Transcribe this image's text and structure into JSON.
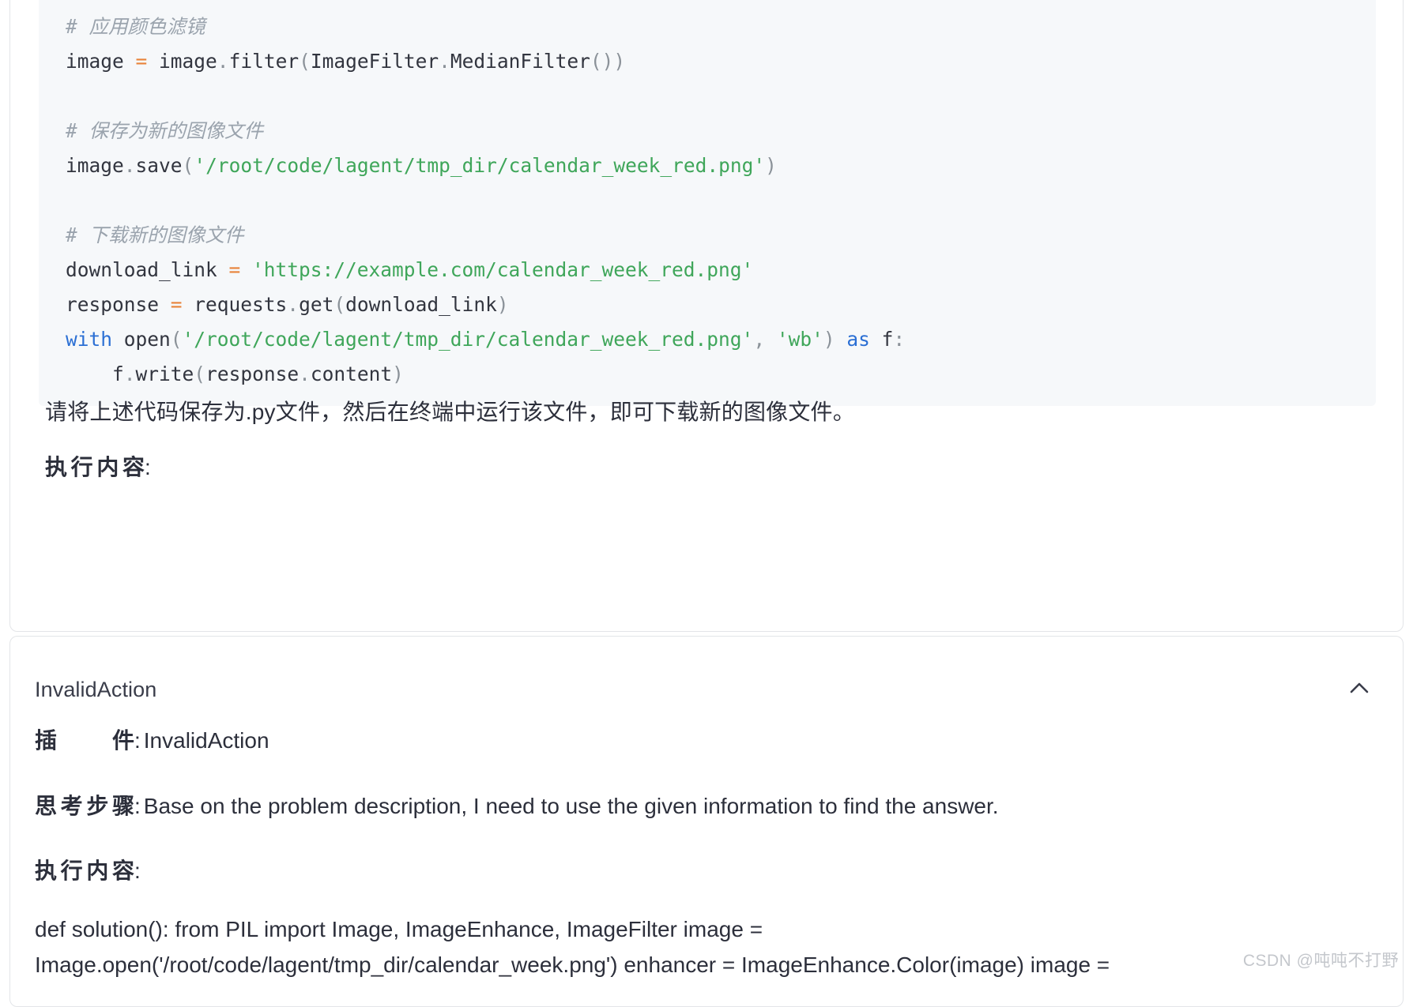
{
  "code_block": {
    "language": "python",
    "lines": [
      [
        {
          "t": "# 应用颜色滤镜",
          "c": "cmt"
        }
      ],
      [
        {
          "t": "image ",
          "c": "pln"
        },
        {
          "t": "=",
          "c": "op"
        },
        {
          "t": " image",
          "c": "pln"
        },
        {
          "t": ".",
          "c": "punc"
        },
        {
          "t": "filter",
          "c": "pln"
        },
        {
          "t": "(",
          "c": "punc"
        },
        {
          "t": "ImageFilter",
          "c": "pln"
        },
        {
          "t": ".",
          "c": "punc"
        },
        {
          "t": "MedianFilter",
          "c": "pln"
        },
        {
          "t": "())",
          "c": "punc"
        }
      ],
      [
        {
          "t": "",
          "c": "pln"
        }
      ],
      [
        {
          "t": "# 保存为新的图像文件",
          "c": "cmt"
        }
      ],
      [
        {
          "t": "image",
          "c": "pln"
        },
        {
          "t": ".",
          "c": "punc"
        },
        {
          "t": "save",
          "c": "pln"
        },
        {
          "t": "(",
          "c": "punc"
        },
        {
          "t": "'/root/code/lagent/tmp_dir/calendar_week_red.png'",
          "c": "str"
        },
        {
          "t": ")",
          "c": "punc"
        }
      ],
      [
        {
          "t": "",
          "c": "pln"
        }
      ],
      [
        {
          "t": "# 下载新的图像文件",
          "c": "cmt"
        }
      ],
      [
        {
          "t": "download_link ",
          "c": "pln"
        },
        {
          "t": "=",
          "c": "op"
        },
        {
          "t": " ",
          "c": "pln"
        },
        {
          "t": "'https://example.com/calendar_week_red.png'",
          "c": "str"
        }
      ],
      [
        {
          "t": "response ",
          "c": "pln"
        },
        {
          "t": "=",
          "c": "op"
        },
        {
          "t": " requests",
          "c": "pln"
        },
        {
          "t": ".",
          "c": "punc"
        },
        {
          "t": "get",
          "c": "pln"
        },
        {
          "t": "(",
          "c": "punc"
        },
        {
          "t": "download_link",
          "c": "pln"
        },
        {
          "t": ")",
          "c": "punc"
        }
      ],
      [
        {
          "t": "with",
          "c": "kw"
        },
        {
          "t": " open",
          "c": "pln"
        },
        {
          "t": "(",
          "c": "punc"
        },
        {
          "t": "'/root/code/lagent/tmp_dir/calendar_week_red.png'",
          "c": "str"
        },
        {
          "t": ", ",
          "c": "punc"
        },
        {
          "t": "'wb'",
          "c": "str"
        },
        {
          "t": ")",
          "c": "punc"
        },
        {
          "t": " as",
          "c": "kw"
        },
        {
          "t": " f",
          "c": "pln"
        },
        {
          "t": ":",
          "c": "punc"
        }
      ],
      [
        {
          "t": "    f",
          "c": "pln"
        },
        {
          "t": ".",
          "c": "punc"
        },
        {
          "t": "write",
          "c": "pln"
        },
        {
          "t": "(",
          "c": "punc"
        },
        {
          "t": "response",
          "c": "pln"
        },
        {
          "t": ".",
          "c": "punc"
        },
        {
          "t": "content",
          "c": "pln"
        },
        {
          "t": ")",
          "c": "punc"
        }
      ]
    ]
  },
  "assistant": {
    "save_instruction": "请将上述代码保存为.py文件，然后在终端中运行该文件，即可下载新的图像文件。",
    "exec_label": "执行内容",
    "colon": ":"
  },
  "invalid_action": {
    "header_title": "InvalidAction",
    "collapse_icon": "chevron-up-icon",
    "plugin_label": "插件",
    "plugin_value": "InvalidAction",
    "thought_label": "思考步骤",
    "thought_value": "Base on the problem description, I need to use the given information to find the answer.",
    "exec_label": "执行内容",
    "colon": ":",
    "exec_value": "def solution(): from PIL import Image, ImageEnhance, ImageFilter image = Image.open('/root/code/lagent/tmp_dir/calendar_week.png') enhancer = ImageEnhance.Color(image) image ="
  },
  "watermark": {
    "text": "CSDN @吨吨不打野"
  },
  "colors": {
    "page_bg": "#ffffff",
    "card_border": "#e3e5e8",
    "code_bg": "#f6f8fa",
    "text": "#2c2f3b",
    "comment": "#9aa3ad",
    "string": "#3fa65a",
    "keyword": "#2b6fd4",
    "operator": "#e8833a",
    "punctuation": "#8b9299",
    "watermark": "#c4c7cc"
  }
}
